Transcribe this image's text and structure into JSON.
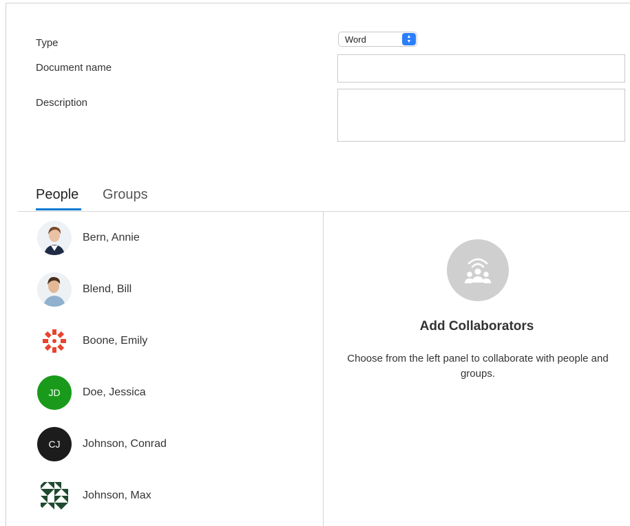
{
  "form": {
    "type_label": "Type",
    "type_value": "Word",
    "name_label": "Document name",
    "name_value": "",
    "description_label": "Description",
    "description_value": ""
  },
  "tabs": [
    {
      "label": "People",
      "active": true
    },
    {
      "label": "Groups",
      "active": false
    }
  ],
  "people": [
    {
      "name": "Bern, Annie",
      "avatar": "photo",
      "initials": ""
    },
    {
      "name": "Blend, Bill",
      "avatar": "photo",
      "initials": ""
    },
    {
      "name": "Boone, Emily",
      "avatar": "red-pattern-icon",
      "initials": ""
    },
    {
      "name": "Doe, Jessica",
      "avatar": "initials",
      "initials": "JD",
      "color": "#1a9a1a"
    },
    {
      "name": "Johnson, Conrad",
      "avatar": "initials",
      "initials": "CJ",
      "color": "#1c1c1c"
    },
    {
      "name": "Johnson, Max",
      "avatar": "green-pattern-icon",
      "initials": ""
    }
  ],
  "collaborators": {
    "icon": "people-group-icon",
    "title": "Add Collaborators",
    "description": "Choose from the left panel to collaborate with people and groups."
  },
  "colors": {
    "accent": "#0078d4",
    "select_arrow": "#2d7ff9",
    "placeholder_circle": "#cfcfcf"
  }
}
